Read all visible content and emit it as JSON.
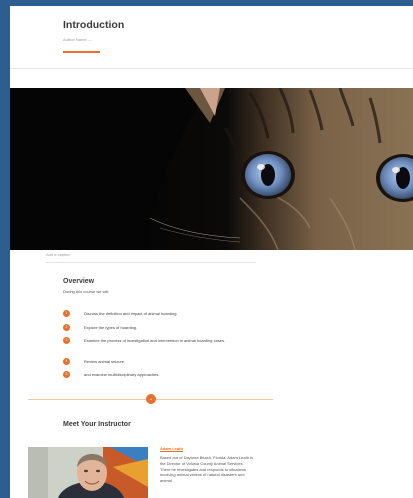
{
  "page": {
    "title": "Introduction",
    "author": "Author Name —",
    "accent_color": "#e8702a"
  },
  "hero": {
    "caption": "Add a caption"
  },
  "overview": {
    "title": "Overview",
    "subtitle": "During this course we will:",
    "objectives": [
      {
        "number": "1",
        "text": "Discuss the definition and impact of animal hoarding."
      },
      {
        "number": "2",
        "text": "Explore the types of hoarding."
      },
      {
        "number": "3",
        "text": "Examine the process of investigation and intervention in animal hoarding cases."
      },
      {
        "number": "4",
        "text": "Review animal seizure."
      },
      {
        "number": "5",
        "text": "and examine multidisciplinary approaches."
      }
    ]
  },
  "divider": {
    "icon": "chevron-down-icon",
    "glyph": "⌄"
  },
  "instructor": {
    "section_title": "Meet Your Instructor",
    "name": "Adam Leath",
    "bio": "Based out of Daytona Beach, Florida, Adam Leath is the Director of Volusia County Animal Services. There he investigates and responds to situations involving animal victims of natural disasters and animal"
  }
}
